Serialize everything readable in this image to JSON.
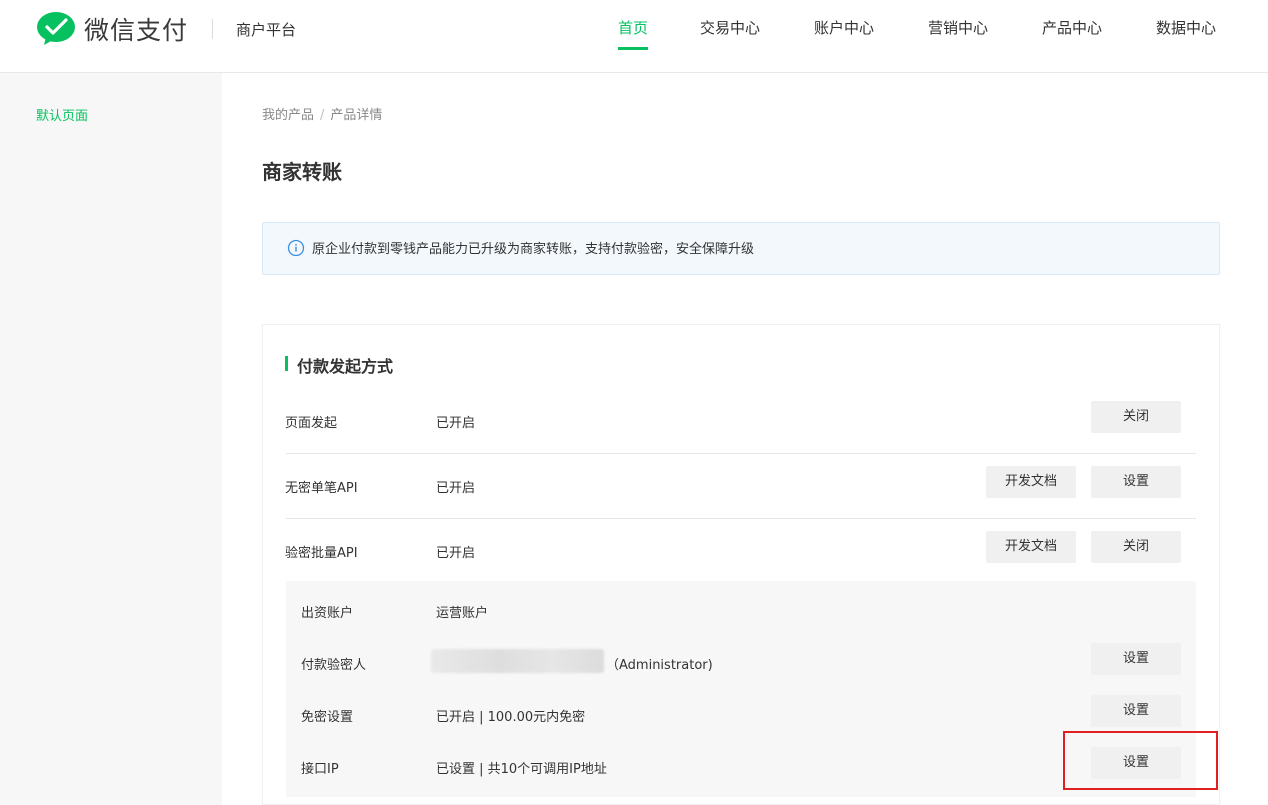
{
  "header": {
    "logo_text": "微信支付",
    "platform": "商户平台",
    "nav": [
      {
        "label": "首页",
        "active": true
      },
      {
        "label": "交易中心",
        "active": false
      },
      {
        "label": "账户中心",
        "active": false
      },
      {
        "label": "营销中心",
        "active": false
      },
      {
        "label": "产品中心",
        "active": false
      },
      {
        "label": "数据中心",
        "active": false
      }
    ]
  },
  "sidebar": {
    "items": [
      {
        "label": "默认页面",
        "active": true
      }
    ]
  },
  "breadcrumb": {
    "items": [
      "我的产品",
      "产品详情"
    ],
    "separator": "/"
  },
  "page_title": "商家转账",
  "notice": {
    "icon": "info-circle-icon",
    "text": "原企业付款到零钱产品能力已升级为商家转账，支持付款验密，安全保障升级"
  },
  "section": {
    "title": "付款发起方式",
    "rows": [
      {
        "label": "页面发起",
        "value": "已开启",
        "buttons": [
          "关闭"
        ]
      },
      {
        "label": "无密单笔API",
        "value": "已开启",
        "buttons": [
          "开发文档",
          "设置"
        ]
      },
      {
        "label": "验密批量API",
        "value": "已开启",
        "buttons": [
          "开发文档",
          "关闭"
        ]
      }
    ],
    "sub_rows": [
      {
        "label": "出资账户",
        "value": "运营账户",
        "buttons": []
      },
      {
        "label": "付款验密人",
        "value": "（Administrator)",
        "buttons": [
          "设置"
        ]
      },
      {
        "label": "免密设置",
        "value": "已开启 | 100.00元内免密",
        "buttons": [
          "设置"
        ]
      },
      {
        "label": "接口IP",
        "value": "已设置 | 共10个可调用IP地址",
        "buttons": [
          "设置"
        ]
      }
    ]
  },
  "colors": {
    "accent": "#07c160",
    "highlight": "#e02020",
    "notice_bg": "#f3f8fd",
    "notice_icon": "#3b8fe0"
  }
}
